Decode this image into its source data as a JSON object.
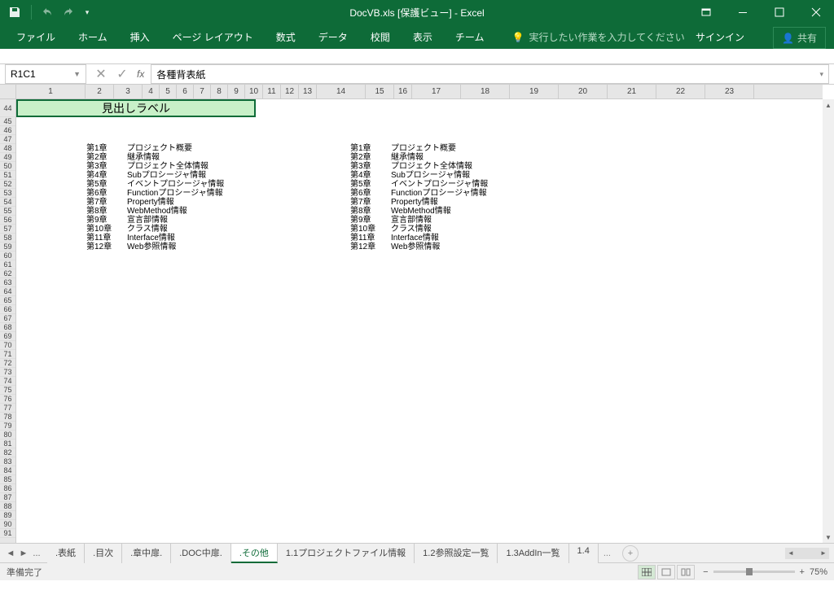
{
  "titlebar": {
    "title": "DocVB.xls [保護ビュー] - Excel"
  },
  "ribbon": {
    "file": "ファイル",
    "tabs": [
      "ホーム",
      "挿入",
      "ページ レイアウト",
      "数式",
      "データ",
      "校閲",
      "表示",
      "チーム"
    ],
    "tellme": "実行したい作業を入力してください",
    "signin": "サインイン",
    "share": "共有"
  },
  "formula": {
    "namebox": "R1C1",
    "fx": "fx",
    "content": "各種背表紙"
  },
  "grid": {
    "col_headers": [
      "1",
      "2",
      "3",
      "4",
      "5",
      "6",
      "7",
      "8",
      "9",
      "10",
      "11",
      "12",
      "13",
      "14",
      "15",
      "16",
      "17",
      "18",
      "19",
      "20",
      "21",
      "22",
      "23"
    ],
    "row_start": 44,
    "row_end": 91,
    "heading_label": "見出しラベル",
    "toc": [
      {
        "ch": "第1章",
        "title": "プロジェクト概要"
      },
      {
        "ch": "第2章",
        "title": "継承情報"
      },
      {
        "ch": "第3章",
        "title": "プロジェクト全体情報"
      },
      {
        "ch": "第4章",
        "title": "Subプロシージャ情報"
      },
      {
        "ch": "第5章",
        "title": "イベントプロシージャ情報"
      },
      {
        "ch": "第6章",
        "title": "Functionプロシージャ情報"
      },
      {
        "ch": "第7章",
        "title": "Property情報"
      },
      {
        "ch": "第8章",
        "title": "WebMethod情報"
      },
      {
        "ch": "第9章",
        "title": "宣言部情報"
      },
      {
        "ch": "第10章",
        "title": "クラス情報"
      },
      {
        "ch": "第11章",
        "title": "Interface情報"
      },
      {
        "ch": "第12章",
        "title": "Web参照情報"
      }
    ]
  },
  "sheets": {
    "ellipsis": "...",
    "tabs": [
      {
        "label": ".表紙",
        "active": false
      },
      {
        "label": ".目次",
        "active": false
      },
      {
        "label": ".章中扉.",
        "active": false
      },
      {
        "label": ".DOC中扉.",
        "active": false
      },
      {
        "label": ".その他",
        "active": true
      },
      {
        "label": "1.1プロジェクトファイル情報",
        "active": false
      },
      {
        "label": "1.2参照設定一覧",
        "active": false
      },
      {
        "label": "1.3AddIn一覧",
        "active": false
      },
      {
        "label": "1.4",
        "active": false
      }
    ],
    "ellipsis2": "..."
  },
  "status": {
    "ready": "準備完了",
    "zoom_pct": "75%"
  }
}
